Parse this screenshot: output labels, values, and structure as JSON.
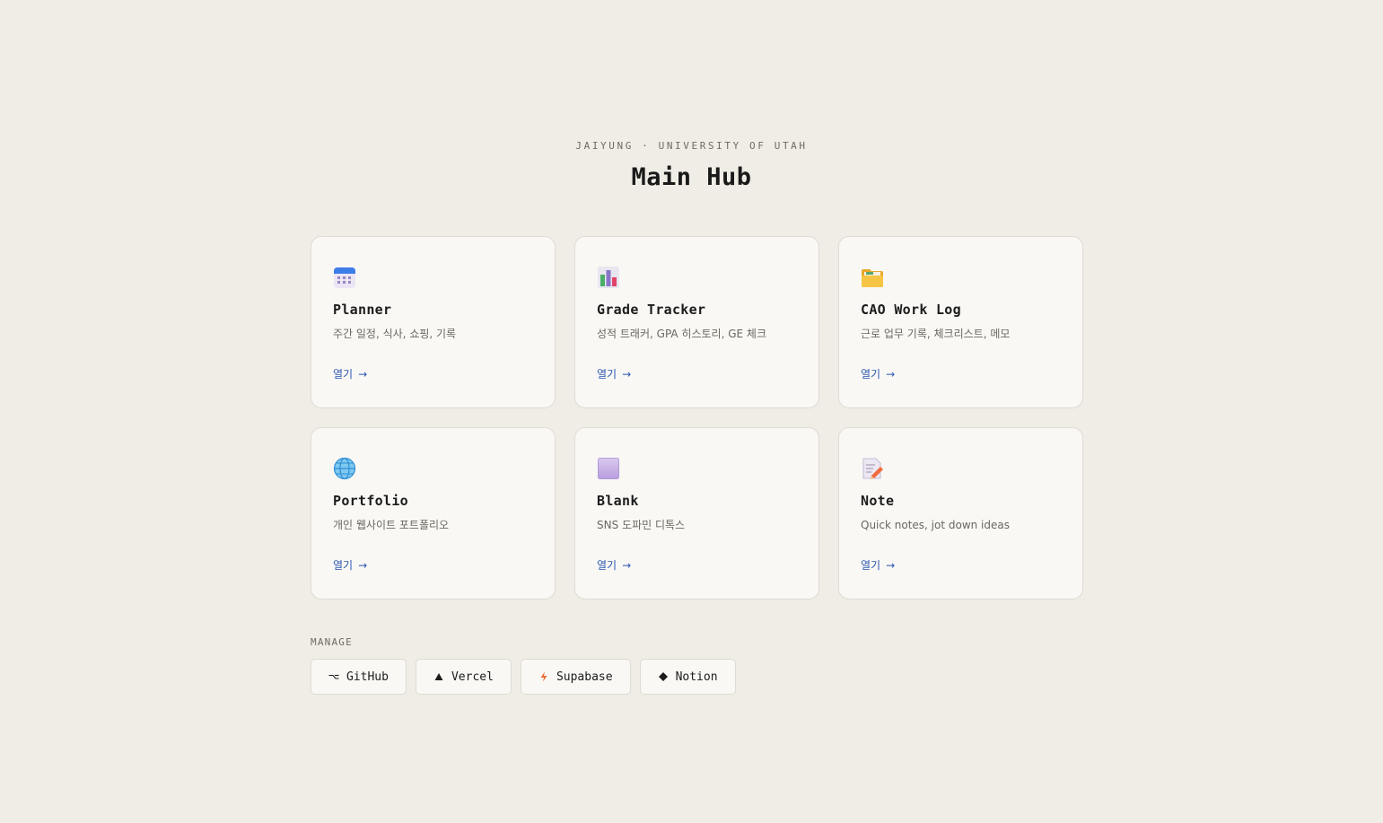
{
  "header": {
    "subtitle": "JAIYUNG · UNIVERSITY OF UTAH",
    "title": "Main Hub"
  },
  "cards": [
    {
      "icon": "calendar-icon",
      "title": "Planner",
      "desc": "주간 일정, 식사, 쇼핑, 기록",
      "link": "열기",
      "arrow": "→"
    },
    {
      "icon": "bar-chart-icon",
      "title": "Grade Tracker",
      "desc": "성적 트래커, GPA 히스토리, GE 체크",
      "link": "열기",
      "arrow": "→"
    },
    {
      "icon": "folder-icon",
      "title": "CAO Work Log",
      "desc": "근로 업무 기록, 체크리스트, 메모",
      "link": "열기",
      "arrow": "→"
    },
    {
      "icon": "globe-icon",
      "title": "Portfolio",
      "desc": "개인 웹사이트 포트폴리오",
      "link": "열기",
      "arrow": "→"
    },
    {
      "icon": "purple-square-icon",
      "title": "Blank",
      "desc": "SNS 도파민 디톡스",
      "link": "열기",
      "arrow": "→"
    },
    {
      "icon": "memo-icon",
      "title": "Note",
      "desc": "Quick notes, jot down ideas",
      "link": "열기",
      "arrow": "→"
    }
  ],
  "manage": {
    "label": "MANAGE",
    "buttons": [
      {
        "icon": "github-icon",
        "label": "GitHub"
      },
      {
        "icon": "vercel-triangle-icon",
        "label": "Vercel"
      },
      {
        "icon": "supabase-bolt-icon",
        "label": "Supabase"
      },
      {
        "icon": "notion-diamond-icon",
        "label": "Notion"
      }
    ]
  },
  "colors": {
    "background": "#f0ede6",
    "card": "#f9f8f5",
    "border": "#dfdbd3",
    "link": "#2b56b0",
    "supabase": "#ee6a2f"
  }
}
